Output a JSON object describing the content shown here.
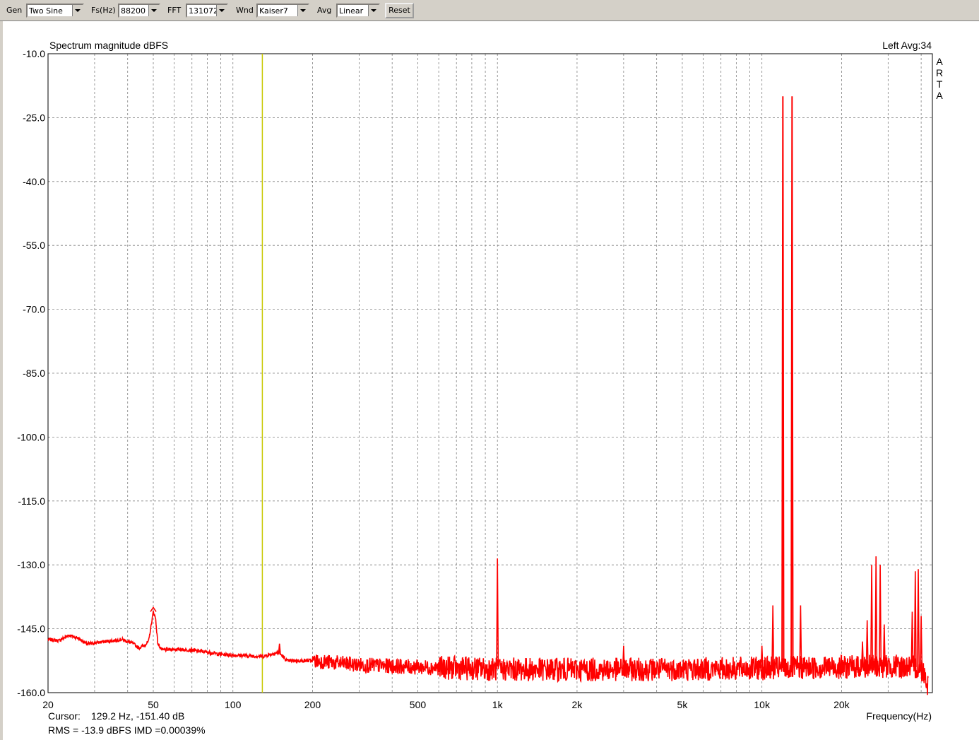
{
  "toolbar": {
    "gen_label": "Gen",
    "gen_value": "Two Sine",
    "fs_label": "Fs(Hz)",
    "fs_value": "88200",
    "fft_label": "FFT",
    "fft_value": "131072",
    "wnd_label": "Wnd",
    "wnd_value": "Kaiser7",
    "avg_label": "Avg",
    "avg_value": "Linear",
    "reset_label": "Reset"
  },
  "chart_data": {
    "type": "line",
    "title": "Spectrum magnitude dBFS",
    "channel_info": "Left  Avg:34",
    "watermark": [
      "A",
      "R",
      "T",
      "A"
    ],
    "xlabel": "Frequency(Hz)",
    "x_scale": "log",
    "xlim": [
      20,
      44100
    ],
    "ylim": [
      -160,
      -10
    ],
    "y_ticks": [
      -10,
      -25,
      -40,
      -55,
      -70,
      -85,
      -100,
      -115,
      -130,
      -145,
      -160
    ],
    "y_tick_labels": [
      "-10.0",
      "-25.0",
      "-40.0",
      "-55.0",
      "-70.0",
      "-85.0",
      "-100.0",
      "-115.0",
      "-130.0",
      "-145.0",
      "-160.0"
    ],
    "x_ticks": [
      20,
      50,
      100,
      200,
      500,
      1000,
      2000,
      5000,
      10000,
      20000
    ],
    "x_tick_labels": [
      "20",
      "50",
      "100",
      "200",
      "500",
      "1k",
      "2k",
      "5k",
      "10k",
      "20k"
    ],
    "grid": true,
    "cursor_label": "Cursor:",
    "cursor_value": "129.2 Hz, -151.40 dB",
    "cursor_freq": 129.2,
    "stats_text": "RMS =  -13.9 dBFS   IMD =0.00039%",
    "colors": {
      "trace": "#ff0000",
      "cursor": "#c8c800",
      "grid": "#808080",
      "stats": "#c00000"
    },
    "noise_floor": [
      [
        20,
        -147.5
      ],
      [
        22,
        -147.8
      ],
      [
        24,
        -146.5
      ],
      [
        26,
        -147.2
      ],
      [
        28,
        -148.6
      ],
      [
        31,
        -148.2
      ],
      [
        34,
        -147.9
      ],
      [
        38,
        -147.5
      ],
      [
        42,
        -148.5
      ],
      [
        44,
        -149.5
      ],
      [
        46,
        -149.0
      ],
      [
        48,
        -148.0
      ],
      [
        50,
        -141.0
      ],
      [
        51,
        -142.5
      ],
      [
        52,
        -148.5
      ],
      [
        54,
        -150.0
      ],
      [
        60,
        -149.8
      ],
      [
        70,
        -150.0
      ],
      [
        80,
        -150.5
      ],
      [
        90,
        -151.0
      ],
      [
        100,
        -151.2
      ],
      [
        130,
        -151.5
      ],
      [
        149,
        -150.5
      ],
      [
        160,
        -152.5
      ],
      [
        200,
        -152.5
      ],
      [
        300,
        -153.5
      ],
      [
        500,
        -154.0
      ],
      [
        1000,
        -154.5
      ],
      [
        2000,
        -154.6
      ],
      [
        5000,
        -154.5
      ],
      [
        10000,
        -154.3
      ],
      [
        20000,
        -154.0
      ],
      [
        30000,
        -153.8
      ],
      [
        38000,
        -154.0
      ],
      [
        41000,
        -155.0
      ],
      [
        42500,
        -158.5
      ]
    ],
    "peaks": [
      {
        "f": 50,
        "db": -140.0
      },
      {
        "f": 150,
        "db": -148.5
      },
      {
        "f": 1000,
        "db": -128.5
      },
      {
        "f": 3000,
        "db": -149.0
      },
      {
        "f": 10000,
        "db": -149.0
      },
      {
        "f": 11000,
        "db": -139.5
      },
      {
        "f": 12000,
        "db": -20.0
      },
      {
        "f": 13000,
        "db": -20.0
      },
      {
        "f": 14000,
        "db": -139.5
      },
      {
        "f": 24000,
        "db": -148.0
      },
      {
        "f": 25000,
        "db": -143.0
      },
      {
        "f": 26000,
        "db": -130.0
      },
      {
        "f": 27000,
        "db": -128.0
      },
      {
        "f": 28000,
        "db": -130.0
      },
      {
        "f": 29000,
        "db": -144.0
      },
      {
        "f": 37000,
        "db": -141.0
      },
      {
        "f": 38000,
        "db": -131.5
      },
      {
        "f": 39000,
        "db": -131.0
      },
      {
        "f": 40000,
        "db": -142.0
      }
    ]
  }
}
